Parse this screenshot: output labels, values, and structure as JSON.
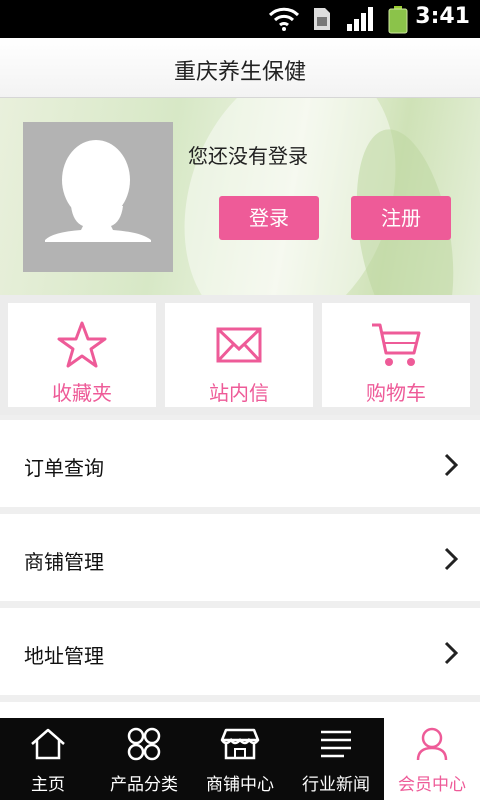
{
  "status_bar": {
    "time": "3:41"
  },
  "header": {
    "title": "重庆养生保健"
  },
  "profile": {
    "status_text": "您还没有登录",
    "login_label": "登录",
    "register_label": "注册"
  },
  "tiles": [
    {
      "label": "收藏夹",
      "icon": "star-icon"
    },
    {
      "label": "站内信",
      "icon": "envelope-icon"
    },
    {
      "label": "购物车",
      "icon": "cart-icon"
    }
  ],
  "menu": [
    {
      "label": "订单查询"
    },
    {
      "label": "商铺管理"
    },
    {
      "label": "地址管理"
    }
  ],
  "bottom_nav": [
    {
      "label": "主页",
      "icon": "home-icon"
    },
    {
      "label": "产品分类",
      "icon": "grid-icon"
    },
    {
      "label": "商铺中心",
      "icon": "store-icon"
    },
    {
      "label": "行业新闻",
      "icon": "news-icon"
    },
    {
      "label": "会员中心",
      "icon": "person-icon",
      "active": true
    }
  ],
  "colors": {
    "accent": "#ee5b98",
    "nav_bg": "#0b0b0b",
    "avatar_bg": "#b3b3b3"
  }
}
